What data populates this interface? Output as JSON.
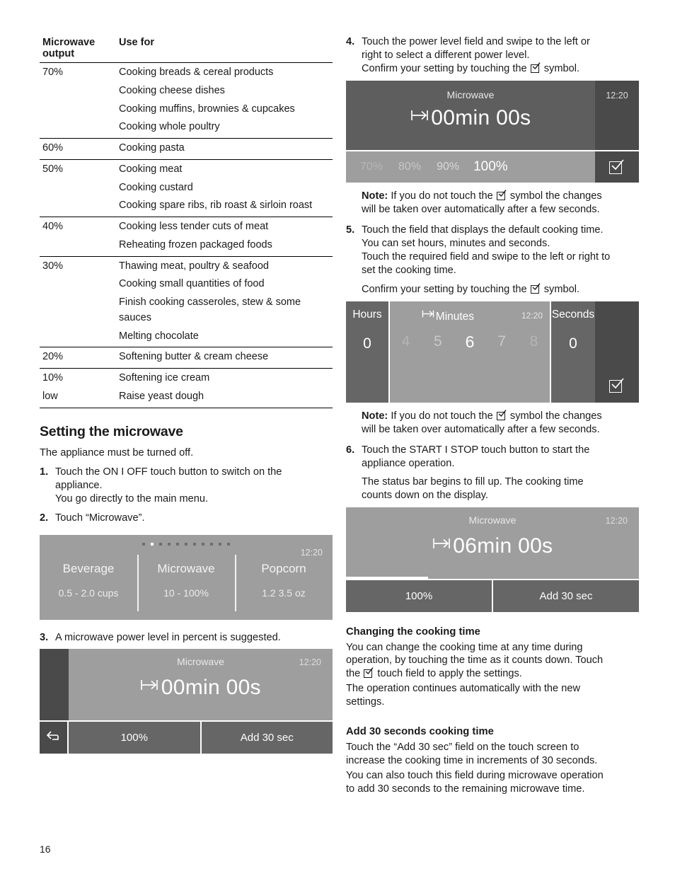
{
  "page": {
    "number": "16"
  },
  "table": {
    "headers": [
      "Microwave output",
      "Use for"
    ],
    "header_line1": "Microwave",
    "header_line2": "output",
    "rows": [
      {
        "output": "70%",
        "uses": [
          "Cooking breads & cereal products",
          "Cooking cheese dishes",
          "Cooking muffins, brownies & cupcakes",
          "Cooking whole poultry"
        ]
      },
      {
        "output": "60%",
        "uses": [
          "Cooking pasta"
        ]
      },
      {
        "output": "50%",
        "uses": [
          "Cooking meat",
          "Cooking custard",
          "Cooking spare ribs, rib roast & sirloin roast"
        ]
      },
      {
        "output": "40%",
        "uses": [
          "Cooking less tender cuts of meat",
          "Reheating frozen packaged foods"
        ]
      },
      {
        "output": "30%",
        "uses": [
          "Thawing meat, poultry & seafood",
          "Cooking small quantities of food",
          "Finish cooking casseroles, stew & some sauces",
          "Melting chocolate"
        ]
      },
      {
        "output": "20%",
        "uses": [
          "Softening butter & cream cheese"
        ]
      },
      {
        "output": "10% low",
        "output_line1": "10%",
        "output_line2": "low",
        "uses": [
          "Softening ice cream",
          "Raise yeast dough"
        ]
      }
    ]
  },
  "setting_section": {
    "heading": "Setting the microwave",
    "intro": "The appliance must be turned off.",
    "step1": {
      "num": "1.",
      "line1": "Touch the ON I OFF  touch button to switch on the",
      "line2": "appliance.",
      "line3": "You go directly to the main menu."
    },
    "step2": {
      "num": "2.",
      "text": "Touch “Microwave”."
    },
    "step3": {
      "num": "3.",
      "text": "A microwave power level in percent is suggested."
    }
  },
  "menu_display": {
    "clock": "12:20",
    "dot_count": 11,
    "active_dot": 2,
    "columns": [
      {
        "name": "Beverage",
        "range": "0.5 - 2.0 cups"
      },
      {
        "name": "Microwave",
        "range": "10 - 100%"
      },
      {
        "name": "Popcorn",
        "range": "1.2  3.5 oz"
      }
    ]
  },
  "mw_display_1": {
    "title": "Microwave",
    "clock": "12:20",
    "time": "00min 00s",
    "back_icon": "back-arrow-icon",
    "power_label": "100%",
    "add30_label": "Add 30 sec"
  },
  "step4": {
    "num": "4.",
    "line1": "Touch the power level field and swipe to the left or",
    "line2": "right to select a different power level.",
    "line3_a": "Confirm your setting by touching the",
    "line3_b": "symbol."
  },
  "power_display": {
    "title": "Microwave",
    "clock": "12:20",
    "time": "00min 00s",
    "levels": [
      "70%",
      "80%",
      "90%",
      "100%"
    ],
    "selected": "100%",
    "confirm_icon": "confirm-check-icon"
  },
  "note1": {
    "label": "Note:",
    "line1": "If you do not touch the",
    "line2": "symbol the changes",
    "line3": "will be taken over automatically after a few seconds."
  },
  "step5": {
    "num": "5.",
    "line1": "Touch the field that displays the default cooking time.",
    "line2": "You can set hours, minutes and seconds.",
    "line3": "Touch the required field and swipe to the left or right to",
    "line4": "set the cooking time.",
    "line5_a": "Confirm your setting by touching the",
    "line5_b": "symbol."
  },
  "time_display": {
    "hours_label": "Hours",
    "hours_value": "0",
    "minutes_label": "Minutes",
    "clock": "12:20",
    "minutes_values": [
      "4",
      "5",
      "6",
      "7",
      "8"
    ],
    "minutes_selected": "6",
    "seconds_label": "Seconds",
    "seconds_value": "0",
    "confirm_icon": "confirm-check-icon"
  },
  "note2": {
    "label": "Note:",
    "line1": "If you do not touch the",
    "line2": "symbol the changes",
    "line3": "will be taken over automatically after a few seconds."
  },
  "step6": {
    "num": "6.",
    "line1": "Touch the START I STOP touch button to start the",
    "line2": "appliance operation.",
    "line3": "The status bar begins to fill up. The cooking time",
    "line4": "counts down on the display."
  },
  "mw_display_2": {
    "title": "Microwave",
    "clock": "12:20",
    "time": "06min 00s",
    "power_label": "100%",
    "add30_label": "Add 30 sec",
    "progress_percent": 28
  },
  "changing_section": {
    "heading": "Changing the cooking time",
    "p1_line1": "You can change the cooking time at any time during",
    "p1_line2": "operation, by touching the time as it counts down. Touch",
    "p1_line3_a": "the",
    "p1_line3_b": "touch field to apply the settings.",
    "p2_line1": "The operation continues automatically with the new",
    "p2_line2": "settings."
  },
  "add30_section": {
    "heading": "Add 30 seconds cooking time",
    "p1_line1": "Touch the “Add 30 sec” field on the touch screen to",
    "p1_line2": "increase the cooking time in increments of 30 seconds.",
    "p2_line1": "You can also touch this field during microwave operation",
    "p2_line2": "to add 30 seconds to the remaining microwave time."
  }
}
